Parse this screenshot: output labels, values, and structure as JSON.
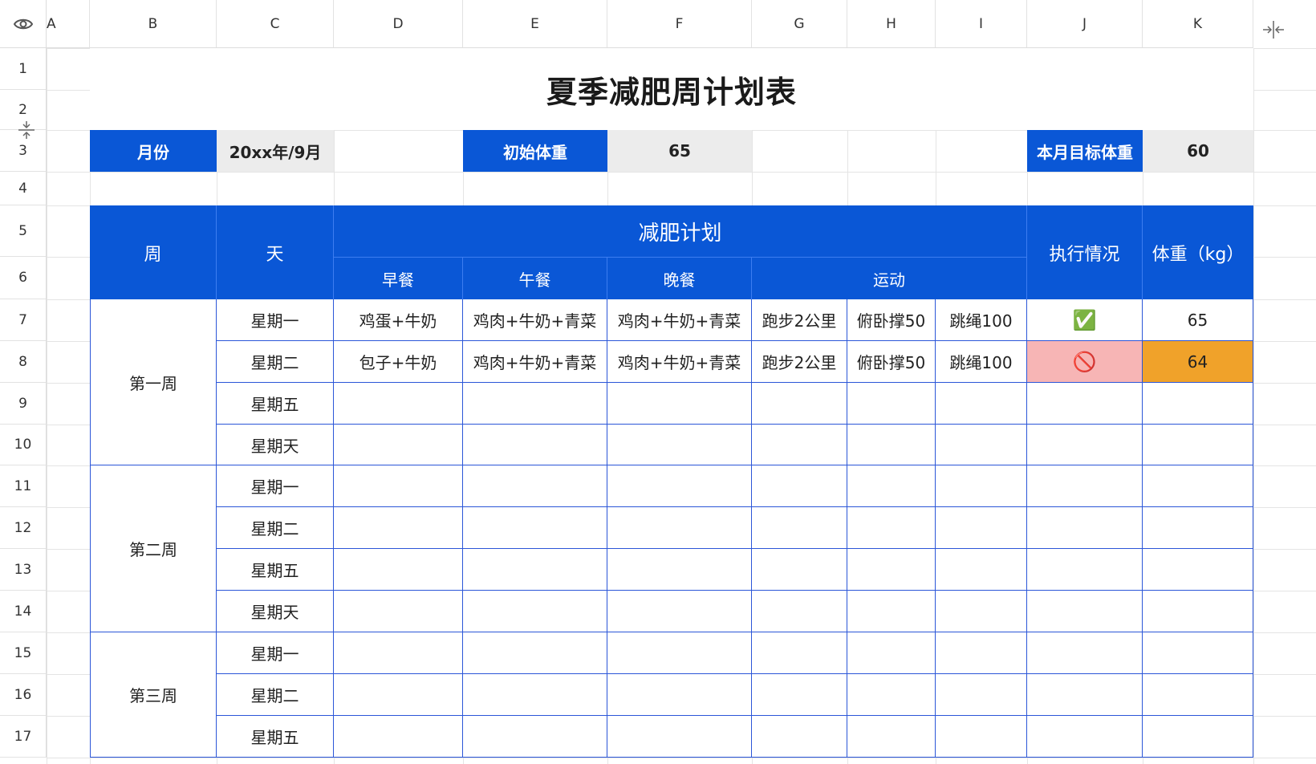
{
  "columns": [
    "A",
    "B",
    "C",
    "D",
    "E",
    "F",
    "G",
    "H",
    "I",
    "J",
    "K"
  ],
  "rows": [
    "1",
    "2",
    "3",
    "4",
    "5",
    "6",
    "7",
    "8",
    "9",
    "10",
    "11",
    "12",
    "13",
    "14",
    "15",
    "16",
    "17"
  ],
  "title": "夏季减肥周计划表",
  "info": {
    "month_label": "月份",
    "month_value": "20xx年/9月",
    "start_weight_label": "初始体重",
    "start_weight_value": "65",
    "target_weight_label": "本月目标体重",
    "target_weight_value": "60"
  },
  "headers": {
    "week": "周",
    "day": "天",
    "plan": "减肥计划",
    "breakfast": "早餐",
    "lunch": "午餐",
    "dinner": "晚餐",
    "exercise": "运动",
    "status": "执行情况",
    "weight": "体重（kg）"
  },
  "weeks": [
    "第一周",
    "第二周",
    "第三周"
  ],
  "entries": [
    {
      "day": "星期一",
      "breakfast": "鸡蛋+牛奶",
      "lunch": "鸡肉+牛奶+青菜",
      "dinner": "鸡肉+牛奶+青菜",
      "ex1": "跑步2公里",
      "ex2": "俯卧撑50",
      "ex3": "跳绳100",
      "status": "✅",
      "weight": "65"
    },
    {
      "day": "星期二",
      "breakfast": "包子+牛奶",
      "lunch": "鸡肉+牛奶+青菜",
      "dinner": "鸡肉+牛奶+青菜",
      "ex1": "跑步2公里",
      "ex2": "俯卧撑50",
      "ex3": "跳绳100",
      "status": "🚫",
      "weight": "64"
    },
    {
      "day": "星期五"
    },
    {
      "day": "星期天"
    },
    {
      "day": "星期一"
    },
    {
      "day": "星期二"
    },
    {
      "day": "星期五"
    },
    {
      "day": "星期天"
    },
    {
      "day": "星期一"
    },
    {
      "day": "星期二"
    },
    {
      "day": "星期五"
    }
  ],
  "colors": {
    "header_blue": "#0a57d6",
    "grid_blue": "#2b56d8",
    "status_fail": "#f7b5b5",
    "weight_highlight": "#f0a22a"
  },
  "icons": {
    "toolbar": "eye-icon",
    "row_resize": "row-resize-icon",
    "col_resize": "column-resize-icon"
  }
}
